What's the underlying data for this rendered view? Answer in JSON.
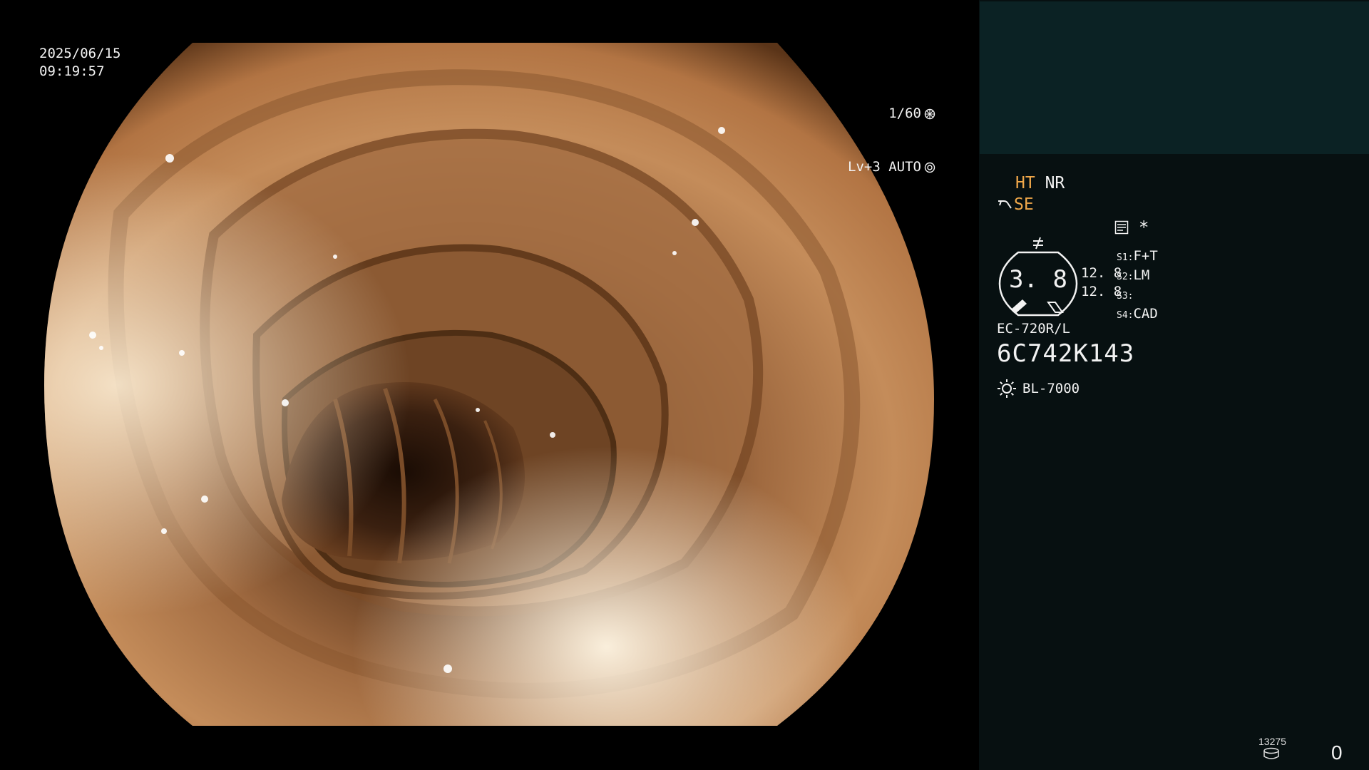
{
  "overlay": {
    "date": "2025/06/15",
    "time": "09:19:57",
    "shutter": "1/60",
    "shutter_icon": "aperture-icon",
    "level_mode": "Lv+3 AUTO",
    "auto_icon": "iris-icon"
  },
  "panel": {
    "mode_ht": "HT",
    "mode_nr": "NR",
    "mode_se": "SE",
    "mode_se_icon": "scope-tip-icon",
    "signal_icon": "not-equal-icon",
    "record_icon": "memo-icon",
    "asterisk": "*",
    "gauge_value": "3. 8",
    "gauge_side_1": "12. 8",
    "gauge_side_2": "12. 8",
    "switches": [
      {
        "key": "S1",
        "value": "F+T"
      },
      {
        "key": "S2",
        "value": "LM"
      },
      {
        "key": "S3",
        "value": ""
      },
      {
        "key": "S4",
        "value": "CAD"
      }
    ],
    "scope_model": "EC-720R/L",
    "serial": "6C742K143",
    "light_source_icon": "sun-icon",
    "light_source": "BL-7000",
    "counter_small": "13275",
    "disk_icon": "disk-icon",
    "counter_main": "0"
  },
  "colors": {
    "panel_bg": "#071011",
    "thumb_bg": "#0b2224",
    "accent_orange": "#f0a84a",
    "text": "#f2f2f2",
    "tissue_light": "#e2b07c",
    "tissue_mid": "#b07a4c",
    "tissue_dark": "#3e2412"
  }
}
